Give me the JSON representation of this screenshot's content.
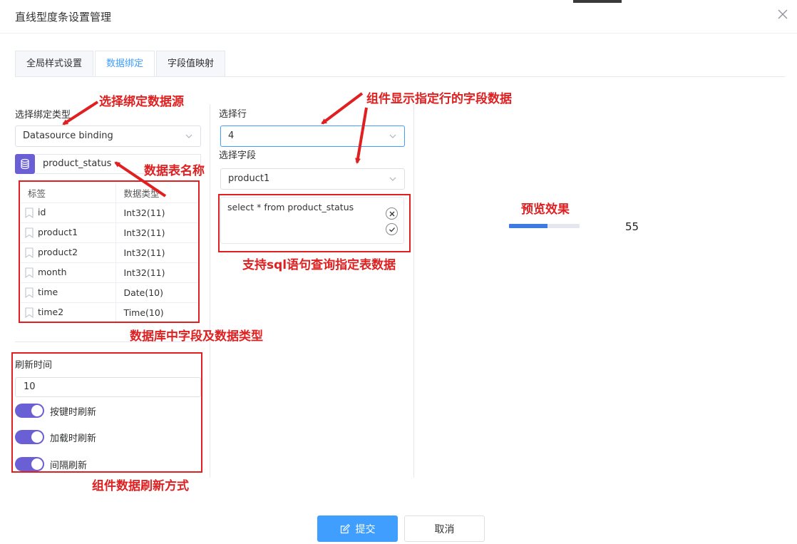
{
  "dialog": {
    "title": "直线型度条设置管理"
  },
  "tabs": [
    {
      "label": "全局样式设置",
      "active": false
    },
    {
      "label": "数据绑定",
      "active": true
    },
    {
      "label": "字段值映射",
      "active": false
    }
  ],
  "binding": {
    "type_label": "选择绑定类型",
    "type_value": "Datasource binding",
    "table_name": "product_status",
    "table_icon": "database-icon"
  },
  "fields": {
    "headers": [
      "标签",
      "数据类型"
    ],
    "rows": [
      {
        "name": "id",
        "type": "Int32(11)"
      },
      {
        "name": "product1",
        "type": "Int32(11)"
      },
      {
        "name": "product2",
        "type": "Int32(11)"
      },
      {
        "name": "month",
        "type": "Int32(11)"
      },
      {
        "name": "time",
        "type": "Date(10)"
      },
      {
        "name": "time2",
        "type": "Time(10)"
      }
    ]
  },
  "refresh": {
    "label": "刷新时间",
    "value": "10",
    "switches": [
      {
        "label": "按键时刷新",
        "on": true
      },
      {
        "label": "加载时刷新",
        "on": true
      },
      {
        "label": "间隔刷新",
        "on": true
      }
    ]
  },
  "middle": {
    "row_label": "选择行",
    "row_value": "4",
    "field_label": "选择字段",
    "field_value": "product1",
    "sql": "select * from product_status"
  },
  "preview": {
    "value": "55",
    "fill_fraction": 0.55,
    "bar_color": "#3d7be0"
  },
  "annotations": {
    "datasource": "选择绑定数据源",
    "table_name": "数据表名称",
    "field_types": "数据库中字段及数据类型",
    "refresh_mode": "组件数据刷新方式",
    "row_field": "组件显示指定行的字段数据",
    "sql": "支持sql语句查询指定表数据",
    "preview": "预览效果"
  },
  "footer": {
    "submit": "提交",
    "cancel": "取消"
  },
  "colors": {
    "accent": "#409eff",
    "switch": "#6b5fd6",
    "annotation": "#e02020"
  }
}
